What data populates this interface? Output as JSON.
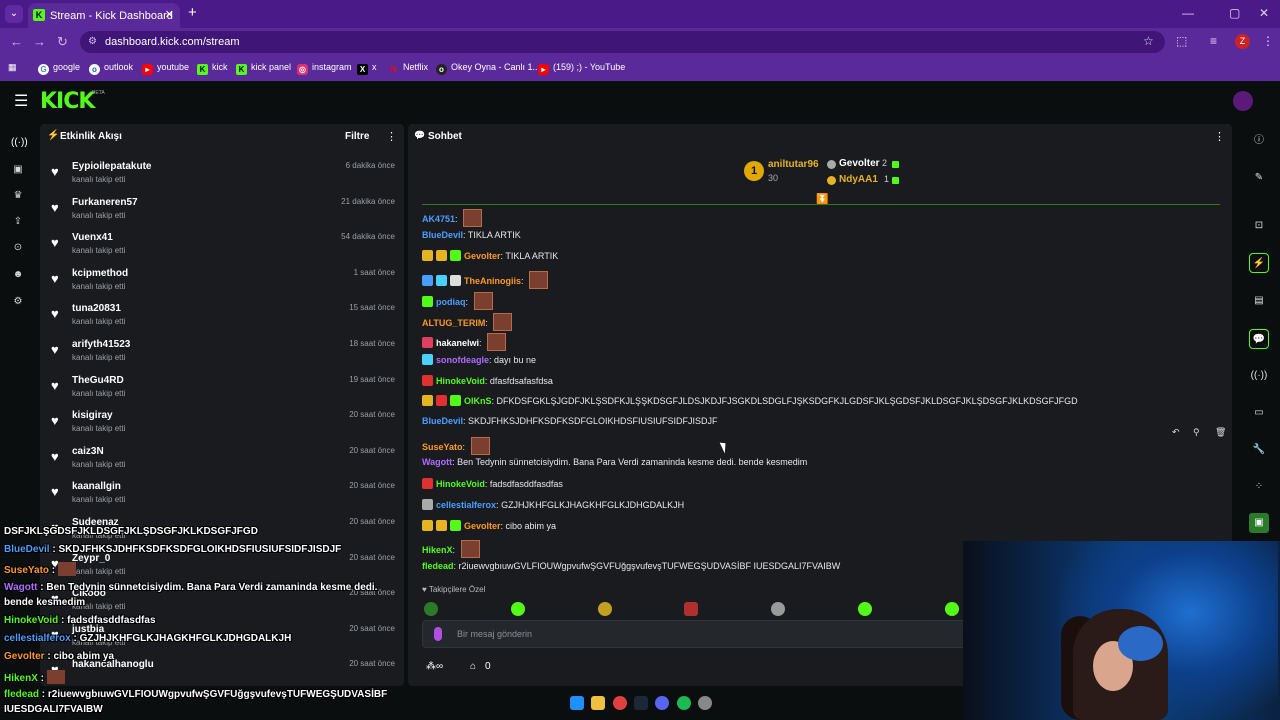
{
  "browser": {
    "tab_title": "Stream - Kick Dashboard",
    "url": "dashboard.kick.com/stream",
    "profile_initial": "Z",
    "bookmarks": [
      "google",
      "outlook",
      "youtube",
      "kick",
      "kick panel",
      "instagram",
      "x",
      "Netflix",
      "Okey Oyna - Canlı 1...",
      "(159) ;) - YouTube"
    ]
  },
  "kick": {
    "logo": "KICK",
    "beta": "BETA"
  },
  "activity": {
    "title": "Etkinlik Akışı",
    "filter": "Filtre",
    "items": [
      {
        "name": "Eypioilepatakute",
        "sub": "kanalı takip etti",
        "time": "6 dakika önce"
      },
      {
        "name": "Furkaneren57",
        "sub": "kanalı takip etti",
        "time": "21 dakika önce"
      },
      {
        "name": "Vuenx41",
        "sub": "kanalı takip etti",
        "time": "54 dakika önce"
      },
      {
        "name": "kcipmethod",
        "sub": "kanalı takip etti",
        "time": "1 saat önce"
      },
      {
        "name": "tuna20831",
        "sub": "kanalı takip etti",
        "time": "15 saat önce"
      },
      {
        "name": "arifyth41523",
        "sub": "kanalı takip etti",
        "time": "18 saat önce"
      },
      {
        "name": "TheGu4RD",
        "sub": "kanalı takip etti",
        "time": "19 saat önce"
      },
      {
        "name": "kisigiray",
        "sub": "kanalı takip etti",
        "time": "20 saat önce"
      },
      {
        "name": "caiz3N",
        "sub": "kanalı takip etti",
        "time": "20 saat önce"
      },
      {
        "name": "kaanallgin",
        "sub": "kanalı takip etti",
        "time": "20 saat önce"
      },
      {
        "name": "Sudeenaz",
        "sub": "kanalı takip etti",
        "time": "20 saat önce"
      },
      {
        "name": "Zeypr_0",
        "sub": "kanalı takip etti",
        "time": "20 saat önce"
      },
      {
        "name": "Cikooo",
        "sub": "kanalı takip etti",
        "time": "20 saat önce"
      },
      {
        "name": "justbia",
        "sub": "kanalı takip etti",
        "time": "20 saat önce"
      },
      {
        "name": "hakancalhanoglu",
        "sub": "",
        "time": "20 saat önce"
      }
    ]
  },
  "chat": {
    "title": "Sohbet",
    "gifters": {
      "top_rank": "1",
      "top_user": "aniltutar96",
      "top_count": "30",
      "u2": "Gevolter",
      "c2": "2",
      "u3": "NdyAA1",
      "c3": "1"
    },
    "messages": [
      {
        "user": "AK4751",
        "color": "#4a9eff",
        "text": ""
      },
      {
        "user": "BlueDevil",
        "color": "#4a9eff",
        "text": "TIKLA ARTIK"
      },
      {
        "user": "Gevolter",
        "color": "#ff9a1f",
        "text": "TIKLA ARTIK"
      },
      {
        "user": "TheAninogiis",
        "color": "#ff9a1f",
        "text": ""
      },
      {
        "user": "podiaq",
        "color": "#4a9eff",
        "text": ""
      },
      {
        "user": "ALTUG_TERIM",
        "color": "#ff9a1f",
        "text": ""
      },
      {
        "user": "hakanelwi",
        "color": "#ffffff",
        "text": ""
      },
      {
        "user": "sonofdeagle",
        "color": "#b06cff",
        "text": "dayı bu ne"
      },
      {
        "user": "HinokeVoid",
        "color": "#53fc18",
        "text": "dfasfdsafasfdsa"
      },
      {
        "user": "OlKnS",
        "color": "#53fc18",
        "text": "DFKDSFGKLŞJGDFJKLŞSDFKJLŞŞKDSGFJLDSJKDJFJSGKDLSDGLFJŞKSDGFKJLGDSFJKLŞGDSFJKLDSGFJKLŞDSGFJKLKDSGFJFGD"
      },
      {
        "user": "BlueDevil",
        "color": "#4a9eff",
        "text": "SKDJFHKSJDHFKSDFKSDFGLOIKHDSFIUSIUFSIDFJISDJF"
      },
      {
        "user": "SuseYato",
        "color": "#ff9a1f",
        "text": ""
      },
      {
        "user": "Wagott",
        "color": "#b06cff",
        "text": "Ben Tedynin sünnetcisiydim. Bana Para Verdi zamaninda kesme dedi. bende kesmedim"
      },
      {
        "user": "HinokeVoid",
        "color": "#53fc18",
        "text": "fadsdfasddfasdfas"
      },
      {
        "user": "cellestialferox",
        "color": "#4a9eff",
        "text": "GZJHJKHFGLKJHAGKHFGLKJDHGDALKJH"
      },
      {
        "user": "Gevolter",
        "color": "#ff9a1f",
        "text": "cibo abim ya"
      },
      {
        "user": "HikenX",
        "color": "#53fc18",
        "text": ""
      },
      {
        "user": "fledead",
        "color": "#53fc18",
        "text": "r2iuewvgbıuwGVLFIOUWgpvufwŞGVFUğgşvufevşTUFWEGŞUDVASİBF IUESDGALI7FVAIBW"
      }
    ],
    "subscribers_label": "Takipçilere Özel",
    "input_placeholder": "Bir mesaj gönderin",
    "bottom_count": "0"
  },
  "overlay": {
    "lines": [
      {
        "user": "",
        "text": "DSFJKLŞGDSFJKLDSGFJKLŞDSGFJKLKDSGFJFGD",
        "color": "#ffffff"
      },
      {
        "user": "BlueDevil",
        "text": "SKDJFHKSJDHFKSDFKSDFGLOIKHDSFIUSIUFSIDFJISDJF",
        "color": "#4a9eff"
      },
      {
        "user": "SuseYato",
        "text": "",
        "color": "#ff9a1f"
      },
      {
        "user": "Wagott",
        "text": "Ben Tedynin sünnetcisiydim. Bana Para Verdi zamaninda kesme dedi.",
        "color": "#b06cff"
      },
      {
        "user": "",
        "text": "bende kesmedim",
        "color": "#ffffff"
      },
      {
        "user": "HinokeVoid",
        "text": "fadsdfasddfasdfas",
        "color": "#53fc18"
      },
      {
        "user": "cellestialferox",
        "text": "GZJHJKHFGLKJHAGKHFGLKJDHGDALKJH",
        "color": "#4a9eff"
      },
      {
        "user": "Gevolter",
        "text": "cibo abim ya",
        "color": "#ff9a1f"
      },
      {
        "user": "HikenX",
        "text": "",
        "color": "#53fc18"
      },
      {
        "user": "fledead",
        "text": "r2iuewvgbıuwGVLFIOUWgpvufwŞGVFUğgşvufevşTUFWEGŞUDVASİBF",
        "color": "#53fc18"
      },
      {
        "user": "",
        "text": "IUESDGALI7FVAIBW",
        "color": "#ffffff"
      }
    ]
  },
  "colors": {
    "accent": "#53fc18",
    "browser": "#5b2a9a",
    "panel": "#191b1f"
  }
}
